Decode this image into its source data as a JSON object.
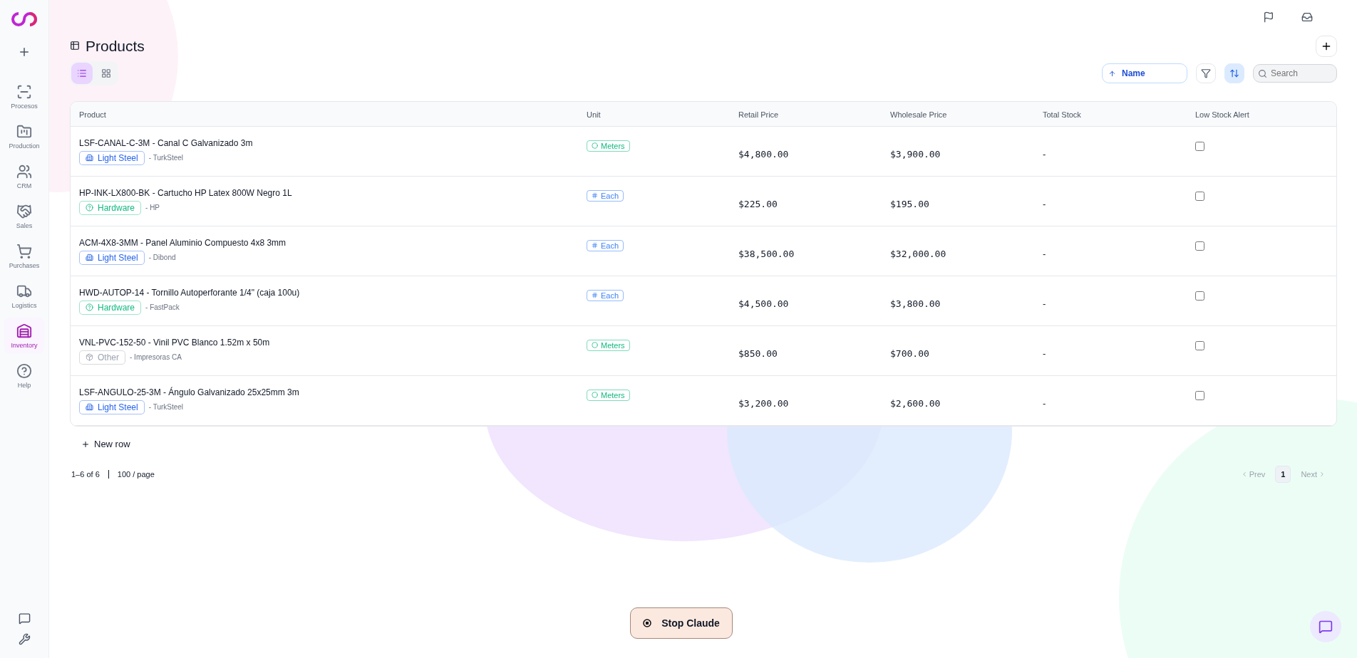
{
  "sidebar": {
    "items": [
      {
        "label": "Procesos",
        "selected": false
      },
      {
        "label": "Production",
        "selected": false
      },
      {
        "label": "CRM",
        "selected": false
      },
      {
        "label": "Sales",
        "selected": false
      },
      {
        "label": "Purchases",
        "selected": false
      },
      {
        "label": "Logistics",
        "selected": false
      },
      {
        "label": "Inventory",
        "selected": true
      },
      {
        "label": "Help",
        "selected": false
      }
    ]
  },
  "page": {
    "title": "Products"
  },
  "view_toggle": [
    {
      "kind": "list",
      "selected": true
    },
    {
      "kind": "grid",
      "selected": false
    }
  ],
  "toolbar": {
    "sort_field": "Name",
    "sort_active": true,
    "search": {
      "placeholder": "Search"
    }
  },
  "table": {
    "columns": [
      "Product",
      "Unit",
      "Retail Price",
      "Wholesale Price",
      "Total Stock",
      "Low Stock Alert"
    ],
    "rows": [
      {
        "name": "LSF-CANAL-C-3M - Canal C Galvanizado 3m",
        "category": {
          "label": "Light Steel",
          "kind": "steel",
          "color": "#2563eb"
        },
        "supplier": "- TurkSteel",
        "unit": {
          "label": "Meters",
          "kind": "length",
          "color": "#10b981"
        },
        "retail": "$4,800.00",
        "wholesale": "$3,900.00",
        "stock": "-",
        "low_stock_alert": false
      },
      {
        "name": "HP-INK-LX800-BK - Cartucho HP Latex 800W Negro 1L",
        "category": {
          "label": "Hardware",
          "kind": "hardware",
          "color": "#10b981"
        },
        "supplier": "- HP",
        "unit": {
          "label": "Each",
          "kind": "count",
          "color": "#3b82f6"
        },
        "retail": "$225.00",
        "wholesale": "$195.00",
        "stock": "-",
        "low_stock_alert": false
      },
      {
        "name": "ACM-4X8-3MM - Panel Aluminio Compuesto 4x8 3mm",
        "category": {
          "label": "Light Steel",
          "kind": "steel",
          "color": "#2563eb"
        },
        "supplier": "- Dibond",
        "unit": {
          "label": "Each",
          "kind": "count",
          "color": "#3b82f6"
        },
        "retail": "$38,500.00",
        "wholesale": "$32,000.00",
        "stock": "-",
        "low_stock_alert": false
      },
      {
        "name": "HWD-AUTOP-14 - Tornillo Autoperforante 1/4\" (caja 100u)",
        "category": {
          "label": "Hardware",
          "kind": "hardware",
          "color": "#10b981"
        },
        "supplier": "- FastPack",
        "unit": {
          "label": "Each",
          "kind": "count",
          "color": "#3b82f6"
        },
        "retail": "$4,500.00",
        "wholesale": "$3,800.00",
        "stock": "-",
        "low_stock_alert": false
      },
      {
        "name": "VNL-PVC-152-50 - Vinil PVC Blanco 1.52m x 50m",
        "category": {
          "label": "Other",
          "kind": "other",
          "color": "#9ca3af"
        },
        "supplier": "- Impresoras CA",
        "unit": {
          "label": "Meters",
          "kind": "length",
          "color": "#10b981"
        },
        "retail": "$850.00",
        "wholesale": "$700.00",
        "stock": "-",
        "low_stock_alert": false
      },
      {
        "name": "LSF-ANGULO-25-3M - Ángulo Galvanizado 25x25mm 3m",
        "category": {
          "label": "Light Steel",
          "kind": "steel",
          "color": "#2563eb"
        },
        "supplier": "- TurkSteel",
        "unit": {
          "label": "Meters",
          "kind": "length",
          "color": "#10b981"
        },
        "retail": "$3,200.00",
        "wholesale": "$2,600.00",
        "stock": "-",
        "low_stock_alert": false
      }
    ]
  },
  "new_row": "New row",
  "footer": {
    "range": "1–6 of 6",
    "page_size": "100 / page"
  },
  "pagination": {
    "prev": {
      "label": "Prev",
      "disabled": true
    },
    "pages": [
      {
        "label": "1",
        "selected": true
      }
    ],
    "next": {
      "label": "Next",
      "disabled": true
    }
  },
  "stop_button": "Stop Claude"
}
